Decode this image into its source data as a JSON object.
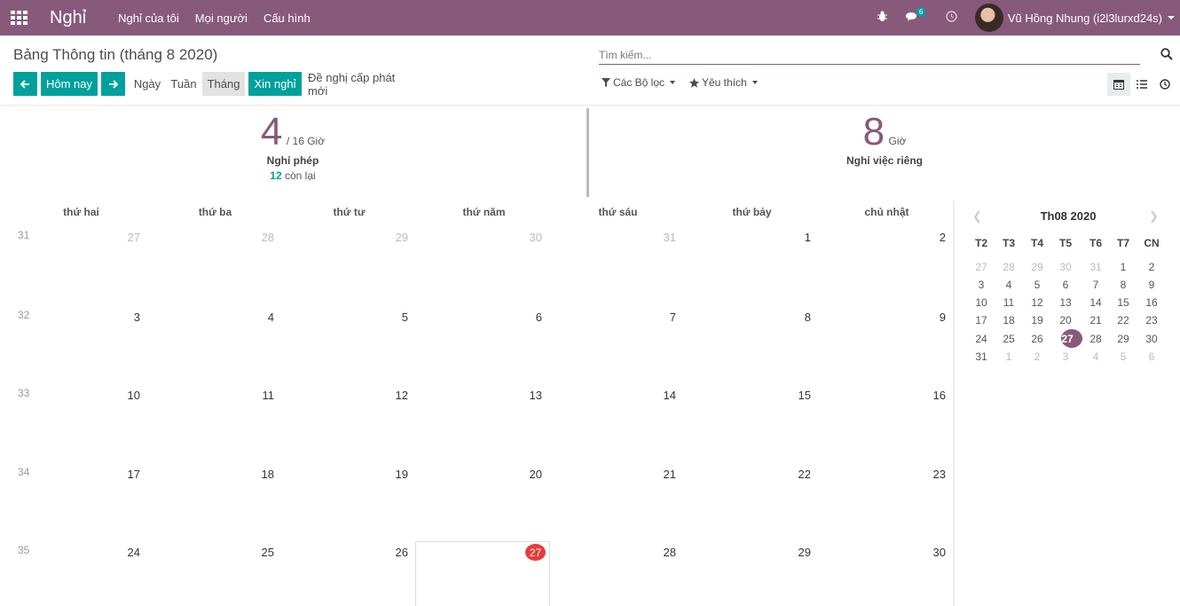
{
  "navbar": {
    "brand": "Nghỉ",
    "menu": [
      "Nghỉ của tôi",
      "Mọi người",
      "Cấu hình"
    ],
    "messages_badge": "6",
    "user_name": "Vũ Hồng Nhung (i2l3lurxd24s)"
  },
  "control": {
    "breadcrumb": "Bảng Thông tin (tháng 8 2020)",
    "search_placeholder": "Tìm kiếm...",
    "today_label": "Hôm nay",
    "scale_day": "Ngày",
    "scale_week": "Tuần",
    "scale_month": "Tháng",
    "request_leave": "Xin nghỉ",
    "new_allocation": "Đề nghị cấp phát mới",
    "filters_label": "Các Bộ lọc",
    "favorites_label": "Yêu thích"
  },
  "summary": {
    "left": {
      "value": "4",
      "unit": "/ 16 Giờ",
      "title": "Nghỉ phép",
      "remaining_value": "12",
      "remaining_label": "còn lại"
    },
    "right": {
      "value": "8",
      "unit": "Giờ",
      "title": "Nghỉ việc riêng"
    }
  },
  "calendar": {
    "day_headers": [
      "thứ hai",
      "thứ ba",
      "thứ tư",
      "thứ năm",
      "thứ sáu",
      "thứ bảy",
      "chủ nhật"
    ],
    "weeks": [
      {
        "num": "31",
        "days": [
          [
            "27",
            true
          ],
          [
            "28",
            true
          ],
          [
            "29",
            true
          ],
          [
            "30",
            true
          ],
          [
            "31",
            true
          ],
          [
            "1",
            false
          ],
          [
            "2",
            false
          ]
        ]
      },
      {
        "num": "32",
        "days": [
          [
            "3",
            false
          ],
          [
            "4",
            false
          ],
          [
            "5",
            false
          ],
          [
            "6",
            false
          ],
          [
            "7",
            false
          ],
          [
            "8",
            false
          ],
          [
            "9",
            false
          ]
        ]
      },
      {
        "num": "33",
        "days": [
          [
            "10",
            false
          ],
          [
            "11",
            false
          ],
          [
            "12",
            false
          ],
          [
            "13",
            false
          ],
          [
            "14",
            false
          ],
          [
            "15",
            false
          ],
          [
            "16",
            false
          ]
        ]
      },
      {
        "num": "34",
        "days": [
          [
            "17",
            false
          ],
          [
            "18",
            false
          ],
          [
            "19",
            false
          ],
          [
            "20",
            false
          ],
          [
            "21",
            false
          ],
          [
            "22",
            false
          ],
          [
            "23",
            false
          ]
        ]
      },
      {
        "num": "35",
        "days": [
          [
            "24",
            false
          ],
          [
            "25",
            false
          ],
          [
            "26",
            false
          ],
          [
            "27",
            false
          ],
          [
            "28",
            false
          ],
          [
            "29",
            false
          ],
          [
            "30",
            false
          ]
        ]
      }
    ],
    "today": "27"
  },
  "mini_calendar": {
    "title": "Th08 2020",
    "headers": [
      "T2",
      "T3",
      "T4",
      "T5",
      "T6",
      "T7",
      "CN"
    ],
    "weeks": [
      [
        [
          "27",
          true
        ],
        [
          "28",
          true
        ],
        [
          "29",
          true
        ],
        [
          "30",
          true
        ],
        [
          "31",
          true
        ],
        [
          "1",
          false
        ],
        [
          "2",
          false
        ]
      ],
      [
        [
          "3",
          false
        ],
        [
          "4",
          false
        ],
        [
          "5",
          false
        ],
        [
          "6",
          false
        ],
        [
          "7",
          false
        ],
        [
          "8",
          false
        ],
        [
          "9",
          false
        ]
      ],
      [
        [
          "10",
          false
        ],
        [
          "11",
          false
        ],
        [
          "12",
          false
        ],
        [
          "13",
          false
        ],
        [
          "14",
          false
        ],
        [
          "15",
          false
        ],
        [
          "16",
          false
        ]
      ],
      [
        [
          "17",
          false
        ],
        [
          "18",
          false
        ],
        [
          "19",
          false
        ],
        [
          "20",
          false
        ],
        [
          "21",
          false
        ],
        [
          "22",
          false
        ],
        [
          "23",
          false
        ]
      ],
      [
        [
          "24",
          false
        ],
        [
          "25",
          false
        ],
        [
          "26",
          false
        ],
        [
          "27",
          false
        ],
        [
          "28",
          false
        ],
        [
          "29",
          false
        ],
        [
          "30",
          false
        ]
      ],
      [
        [
          "31",
          false
        ],
        [
          "1",
          true
        ],
        [
          "2",
          true
        ],
        [
          "3",
          true
        ],
        [
          "4",
          true
        ],
        [
          "5",
          true
        ],
        [
          "6",
          true
        ]
      ]
    ],
    "selected": "27"
  },
  "colors": {
    "brand": "#875a7b",
    "primary": "#00a09d",
    "today": "#e73b3b"
  }
}
